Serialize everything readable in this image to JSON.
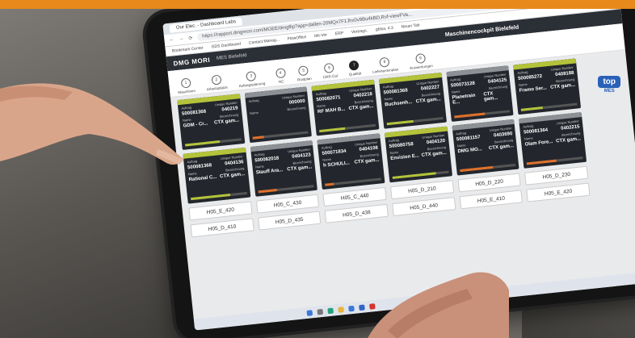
{
  "browser": {
    "tab_title": "Our Elec. - Dashboard Labs",
    "url": "https://rapport.dmgmori.com/MGEE/dmgflip?app=dallen-20MQx7F1Jhx0v9Bu4kBD,Rvf-viewFVa... ",
    "bookmarks": [
      "Bookmark Center",
      "GDS Dashboard",
      "Contact Manag...",
      "FlowOffice",
      "Mit-Vor",
      "ERP",
      "Vertrags.",
      "gfdsa, 4.3",
      "Neuer Tab"
    ]
  },
  "app": {
    "brand": "DMG MORI",
    "site": "MES Bielefeld",
    "title": "Maschinencockpit Bielefeld",
    "steps": [
      {
        "num": "1",
        "label": "Maschinen"
      },
      {
        "num": "2",
        "label": "Arbeitsplätze"
      },
      {
        "num": "3",
        "label": "Auftragsplanung"
      },
      {
        "num": "4",
        "label": "NC"
      },
      {
        "num": "5",
        "label": "Rüstplan"
      },
      {
        "num": "6",
        "label": "CMS-Cal"
      },
      {
        "num": "7",
        "label": "Qualität"
      },
      {
        "num": "8",
        "label": "Lieferterminplan"
      },
      {
        "num": "9",
        "label": "Auswertungen"
      }
    ],
    "mes_logo": "top",
    "mes_label": "MES"
  },
  "field_labels": {
    "order": "Auftrag",
    "unique": "Unique Number",
    "name": "Name",
    "desc": "Bezeichnung"
  },
  "machines": [
    {
      "status": "green",
      "order": "500081368",
      "unique": "040219",
      "name": "GDM - Cr...",
      "desc": "CTX gam...",
      "progress": 0.62
    },
    {
      "status": "grey",
      "order": "",
      "unique": "000000",
      "name": "",
      "desc": "",
      "progress": 0.2
    },
    {
      "status": "green",
      "order": "500082071",
      "unique": "0402218",
      "name": "RF MAH B...",
      "desc": "CTX gam...",
      "progress": 0.45
    },
    {
      "status": "green",
      "order": "500081368",
      "unique": "0402227",
      "name": "Buchsenh...",
      "desc": "CTX gam...",
      "progress": 0.47
    },
    {
      "status": "grey",
      "order": "500073128",
      "unique": "0404125",
      "name": "Planetrain E...",
      "desc": "CTX gam...",
      "progress": 0.55
    },
    {
      "status": "green",
      "order": "500085272",
      "unique": "0408188",
      "name": "Framo Ser...",
      "desc": "CTX gam...",
      "progress": 0.38
    },
    {
      "status": "green",
      "order": "500081368",
      "unique": "0404136",
      "name": "Rational C...",
      "desc": "CTX gam...",
      "progress": 0.7
    },
    {
      "status": "grey",
      "order": "500082018",
      "unique": "0404123",
      "name": "Stauff Ara...",
      "desc": "CTX gam...",
      "progress": 0.33
    },
    {
      "status": "grey",
      "order": "500071834",
      "unique": "0404108",
      "name": "h SCHULI...",
      "desc": "CTX gam...",
      "progress": 0.16
    },
    {
      "status": "green",
      "order": "500080758",
      "unique": "0404120",
      "name": "Envision E...",
      "desc": "CTX gam...",
      "progress": 0.78
    },
    {
      "status": "grey",
      "order": "500081157",
      "unique": "0403690",
      "name": "DMG MO...",
      "desc": "CTX gam...",
      "progress": 0.6
    },
    {
      "status": "grey",
      "order": "500081364",
      "unique": "0402215",
      "name": "Olam Fore...",
      "desc": "CTX gam...",
      "progress": 0.52
    }
  ],
  "machine_names": [
    "H05_E_420",
    "H05_C_430",
    "H05_C_440",
    "H05_D_210",
    "H05_D_220",
    "H05_D_230",
    "H05_D_410",
    "H05_D_435",
    "H05_D_438",
    "H05_D_440",
    "H05_E_410",
    "H05_E_420"
  ]
}
